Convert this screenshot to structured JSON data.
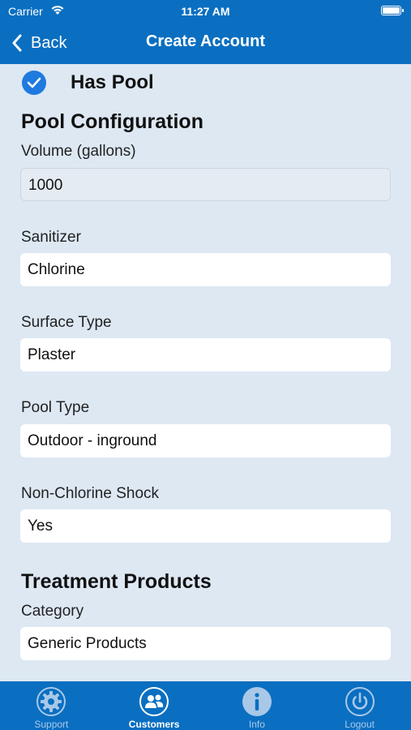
{
  "status_bar": {
    "carrier": "Carrier",
    "time": "11:27 AM"
  },
  "nav": {
    "back_label": "Back",
    "title": "Create Account"
  },
  "has_pool": {
    "label": "Has Pool",
    "checked": true
  },
  "pool_configuration": {
    "title": "Pool Configuration",
    "volume": {
      "label": "Volume (gallons)",
      "value": "1000"
    },
    "sanitizer": {
      "label": "Sanitizer",
      "value": "Chlorine"
    },
    "surface_type": {
      "label": "Surface Type",
      "value": "Plaster"
    },
    "pool_type": {
      "label": "Pool Type",
      "value": "Outdoor - inground"
    },
    "non_chlorine_shock": {
      "label": "Non-Chlorine Shock",
      "value": "Yes"
    }
  },
  "treatment_products": {
    "title": "Treatment Products",
    "category": {
      "label": "Category",
      "value": "Generic Products"
    }
  },
  "tabs": [
    {
      "label": "Support",
      "icon": "gear-icon",
      "active": false
    },
    {
      "label": "Customers",
      "icon": "people-icon",
      "active": true
    },
    {
      "label": "Info",
      "icon": "info-icon",
      "active": false
    },
    {
      "label": "Logout",
      "icon": "power-icon",
      "active": false
    }
  ],
  "colors": {
    "primary": "#0a6fc1",
    "background": "#dde8f3",
    "check": "#1f7ae0"
  }
}
